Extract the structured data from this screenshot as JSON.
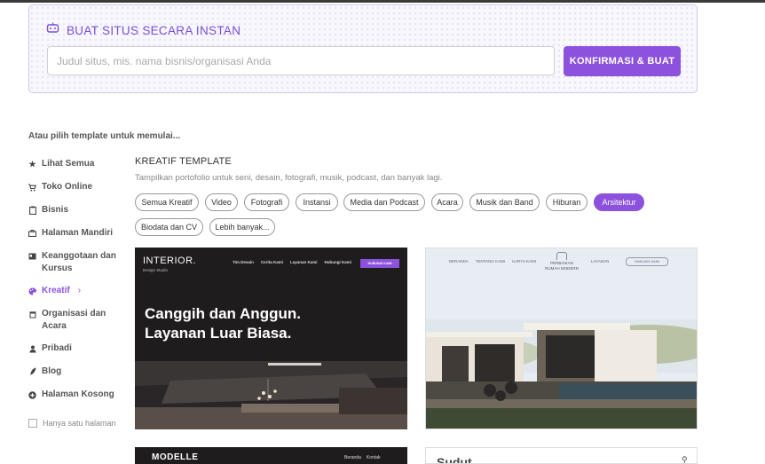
{
  "instant": {
    "title": "BUAT SITUS SECARA INSTAN",
    "input_placeholder": "Judul situs, mis. nama bisnis/organisasi Anda",
    "input_value": "",
    "confirm_label": "KONFIRMASI & BUAT",
    "accent": "#8c52de"
  },
  "choose_label": "Atau pilih template untuk memulai...",
  "sidebar": {
    "items": [
      {
        "label": "Lihat Semua",
        "icon": "star-icon"
      },
      {
        "label": "Toko Online",
        "icon": "cart-icon"
      },
      {
        "label": "Bisnis",
        "icon": "clipboard-icon"
      },
      {
        "label": "Halaman Mandiri",
        "icon": "briefcase-icon"
      },
      {
        "label": "Keanggotaan dan",
        "label2": "Kursus",
        "icon": "id-card-icon"
      },
      {
        "label": "Kreatif",
        "icon": "palette-icon",
        "active": true
      },
      {
        "label": "Organisasi dan",
        "label2": "Acara",
        "icon": "calendar-icon"
      },
      {
        "label": "Pribadi",
        "icon": "user-icon"
      },
      {
        "label": "Blog",
        "icon": "feather-icon"
      },
      {
        "label": "Halaman Kosong",
        "icon": "plus-circle-icon"
      }
    ],
    "only_one_page": "Hanya satu halaman"
  },
  "category": {
    "title": "KREATIF TEMPLATE",
    "description": "Tampilkan portofolio untuk seni, desain, fotografi, musik, podcast, dan banyak lagi.",
    "chips": [
      "Semua Kreatif",
      "Video",
      "Fotografi",
      "Instansi",
      "Media dan Podcast",
      "Acara",
      "Musik dan Band",
      "Hiburan",
      "Arsitektur",
      "Biodata dan CV",
      "Lebih banyak..."
    ],
    "active_chip": "Arsitektur"
  },
  "templates": {
    "interior": {
      "logo": "INTERIOR.",
      "subtitle": "Design Studio",
      "nav": [
        "Tim Desain",
        "Cerita Kami",
        "Layanan Kami",
        "Hubungi Kami"
      ],
      "nav_button": "HUBUNGI KAMI",
      "hero_line1": "Canggih dan Anggun.",
      "hero_line2": "Layanan Luar Biasa."
    },
    "modern_house": {
      "nav": [
        "BERANDA",
        "TENTANG KAMI",
        "KARYA KAMI"
      ],
      "brand_line1": "PERBAIKAN",
      "brand_line2": "RUMAH MODERN",
      "right_nav": "LAYANAN",
      "pill": "HUBUNGI KAMI"
    },
    "modelle": {
      "logo": "MODELLE",
      "nav": [
        "Beranda",
        "Kontak"
      ]
    },
    "sudut": {
      "title": "Sudut"
    }
  }
}
